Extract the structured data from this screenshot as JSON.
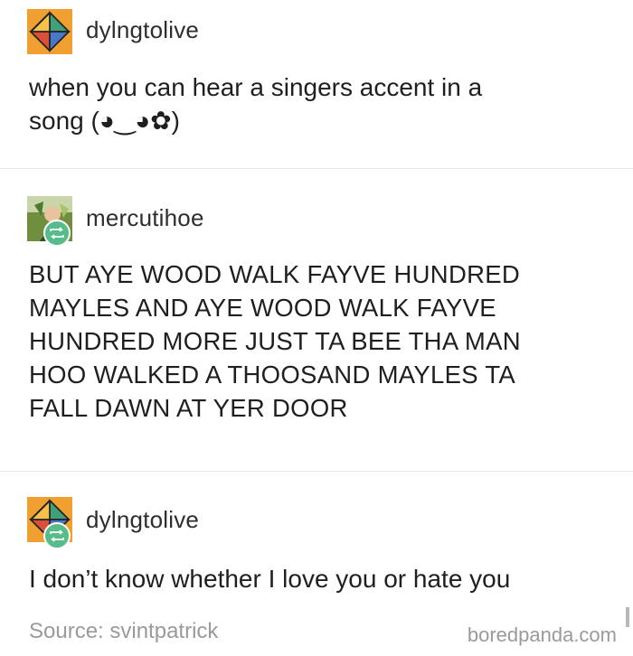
{
  "posts": [
    {
      "username": "dylngtolive",
      "text": "when you can hear a singers accent in a\nsong (◕‿◕✿)",
      "avatar": "geometric-orange-diamond-avatar"
    },
    {
      "username": "mercutihoe",
      "text": "BUT AYE WOOD WALK FAYVE HUNDRED\nMAYLES AND AYE WOOD WALK FAYVE\nHUNDRED MORE JUST TA BEE THA MAN\nHOO WALKED A THOOSAND MAYLES TA\nFALL DAWN AT YER DOOR",
      "avatar": "photo-avatar",
      "reblog_badge": "reblog-icon"
    },
    {
      "username": "dylngtolive",
      "text": "I don’t know whether I love you or hate you",
      "avatar": "geometric-orange-diamond-avatar",
      "reblog_badge": "reblog-icon"
    }
  ],
  "footer": {
    "source": "Source: svintpatrick",
    "brand": "boredpanda.com"
  },
  "colors": {
    "accent_orange": "#f0a030",
    "reblog_green": "#56bc8a",
    "divider": "#e6e6e6",
    "muted_text": "#9a9a9a"
  }
}
